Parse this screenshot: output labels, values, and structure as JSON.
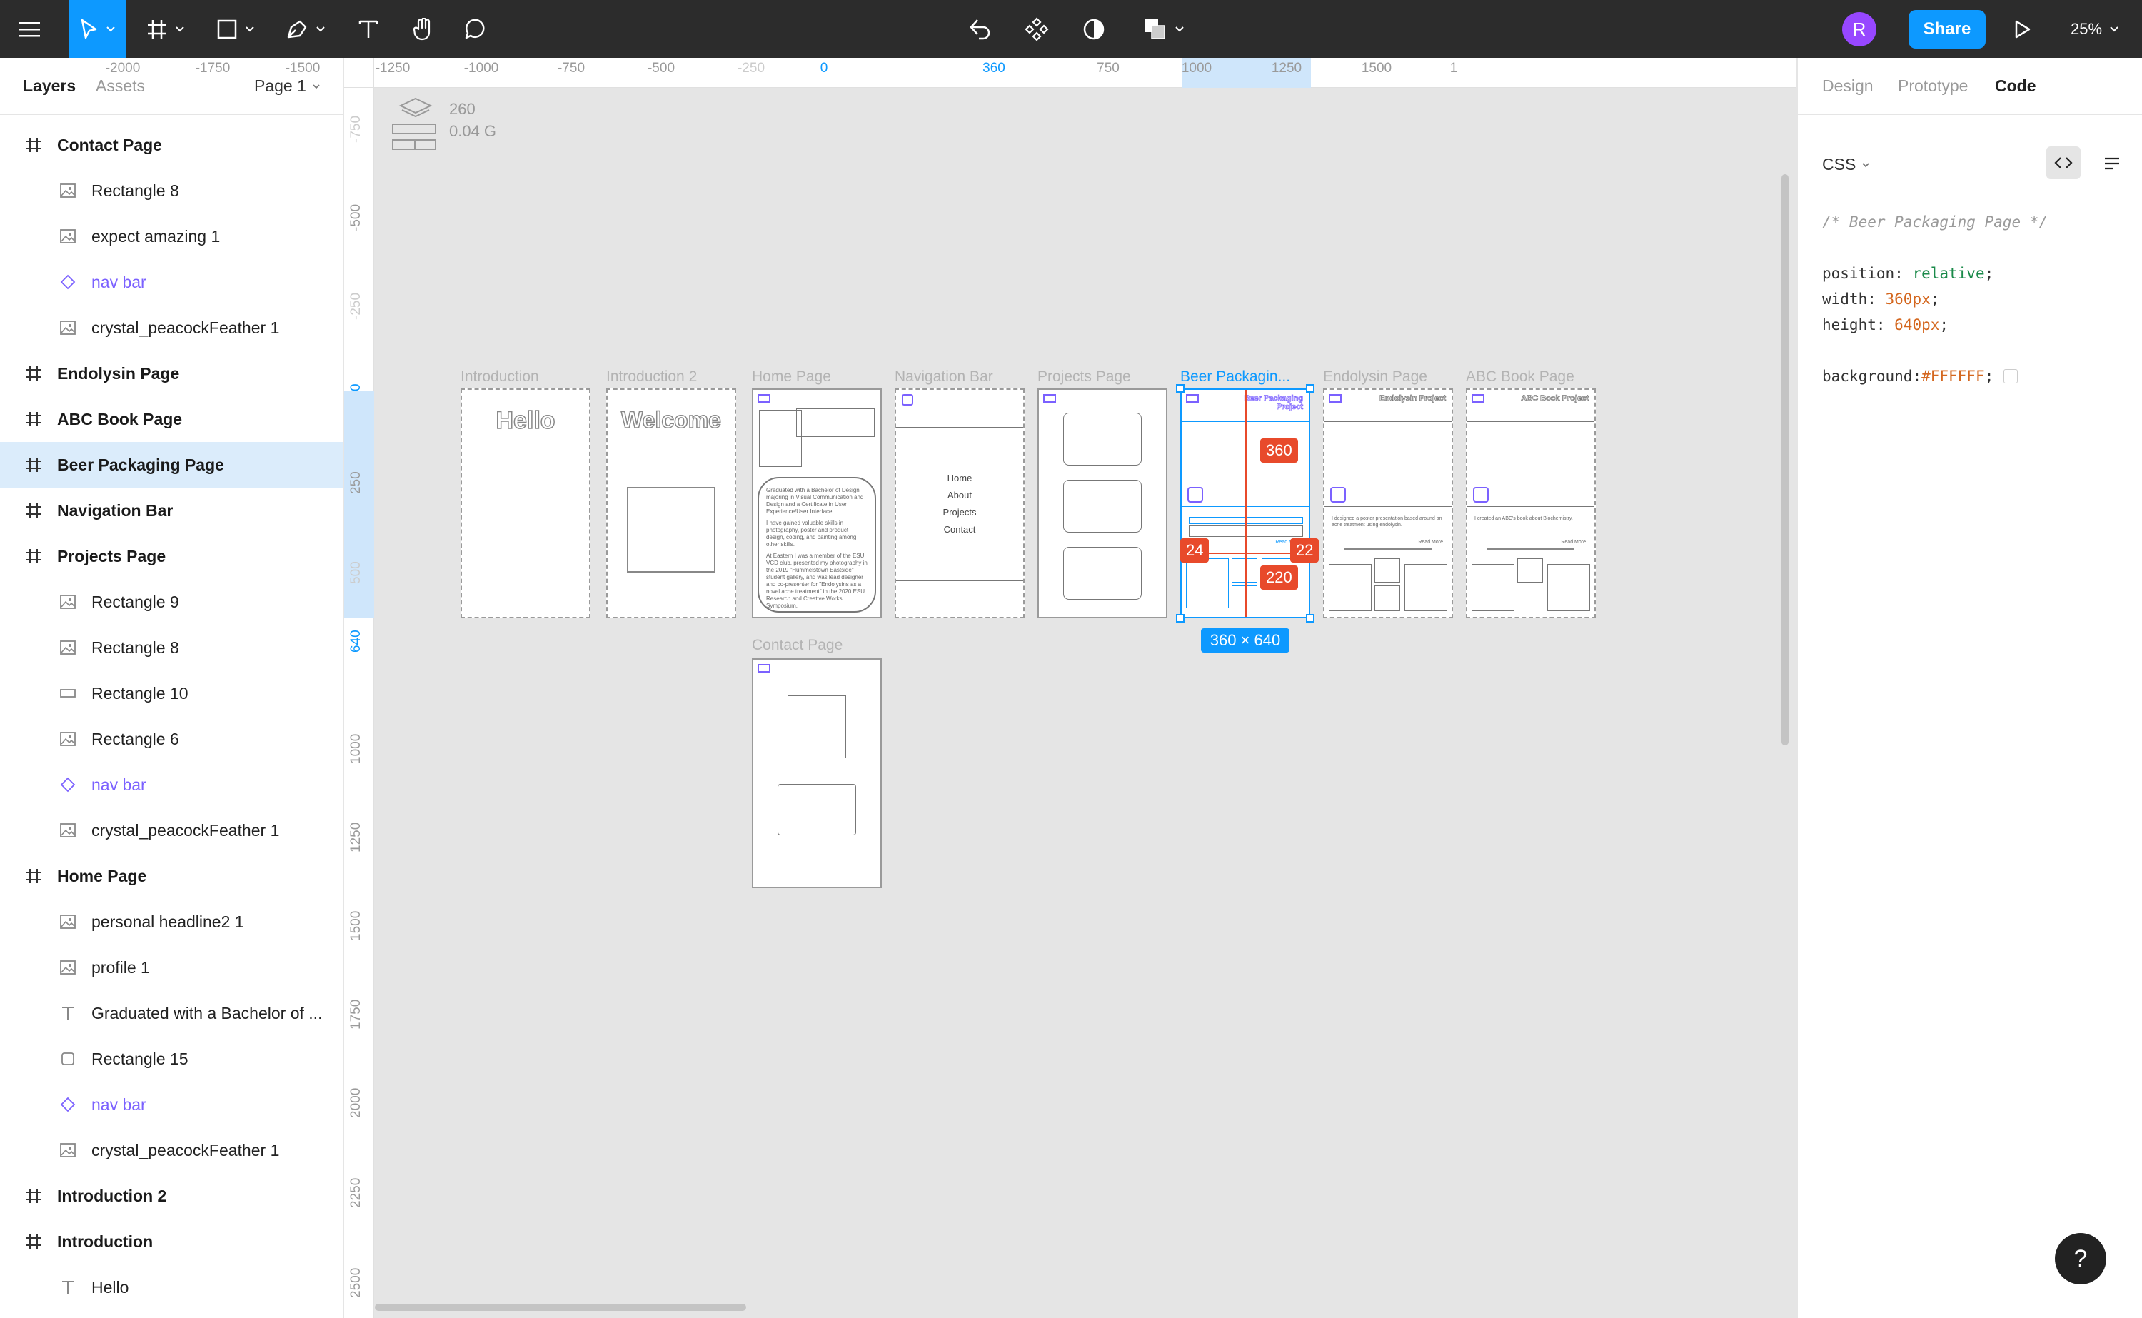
{
  "toolbar": {
    "avatar_initial": "R",
    "share_label": "Share",
    "zoom_label": "25%",
    "icons": [
      "menu-icon",
      "move-tool-icon",
      "frame-tool-icon",
      "shape-tool-icon",
      "pen-tool-icon",
      "text-tool-icon",
      "hand-tool-icon",
      "comment-tool-icon",
      "edit-object-icon",
      "component-icon",
      "mask-icon",
      "boolean-icon",
      "present-icon"
    ]
  },
  "left_panel": {
    "tabs": [
      "Layers",
      "Assets"
    ],
    "page_selector": "Page 1",
    "layers": [
      {
        "label": "Contact Page",
        "kind": "frame"
      },
      {
        "label": "Rectangle 8",
        "kind": "image"
      },
      {
        "label": "expect amazing 1",
        "kind": "image"
      },
      {
        "label": "nav bar",
        "kind": "component"
      },
      {
        "label": "crystal_peacockFeather 1",
        "kind": "image"
      },
      {
        "label": "Endolysin Page",
        "kind": "frame"
      },
      {
        "label": "ABC Book Page",
        "kind": "frame"
      },
      {
        "label": "Beer Packaging Page",
        "kind": "frame",
        "selected": true
      },
      {
        "label": "Navigation Bar",
        "kind": "frame"
      },
      {
        "label": "Projects Page",
        "kind": "frame"
      },
      {
        "label": "Rectangle 9",
        "kind": "image"
      },
      {
        "label": "Rectangle 8",
        "kind": "image"
      },
      {
        "label": "Rectangle 10",
        "kind": "rect"
      },
      {
        "label": "Rectangle 6",
        "kind": "image"
      },
      {
        "label": "nav bar",
        "kind": "component"
      },
      {
        "label": "crystal_peacockFeather 1",
        "kind": "image"
      },
      {
        "label": "Home Page",
        "kind": "frame"
      },
      {
        "label": "personal headline2 1",
        "kind": "image"
      },
      {
        "label": "profile 1",
        "kind": "image"
      },
      {
        "label": "Graduated with a Bachelor of ...",
        "kind": "text"
      },
      {
        "label": "Rectangle 15",
        "kind": "rounded"
      },
      {
        "label": "nav bar",
        "kind": "component"
      },
      {
        "label": "crystal_peacockFeather 1",
        "kind": "image"
      },
      {
        "label": "Introduction 2",
        "kind": "frame"
      },
      {
        "label": "Introduction",
        "kind": "frame"
      },
      {
        "label": "Hello",
        "kind": "text"
      }
    ]
  },
  "rulers": {
    "h_labels": [
      "-2000",
      "-1750",
      "-1500",
      "-1250",
      "-1000",
      "-750",
      "-500",
      "-250",
      "0",
      "360",
      "750",
      "1000",
      "1250",
      "1500",
      "1"
    ],
    "v_labels": [
      "-750",
      "-500",
      "-250",
      "0",
      "250",
      "500",
      "640",
      "1000",
      "1250",
      "1500",
      "1750",
      "2000",
      "2250",
      "2500"
    ]
  },
  "canvas": {
    "stats": {
      "count": "260",
      "size": "0.04 G"
    },
    "frames": [
      {
        "title": "Introduction",
        "content": "Hello"
      },
      {
        "title": "Introduction 2",
        "content": "Welcome"
      },
      {
        "title": "Home Page"
      },
      {
        "title": "Navigation Bar",
        "nav_items": [
          "Home",
          "About",
          "Projects",
          "Contact"
        ]
      },
      {
        "title": "Projects Page"
      },
      {
        "title": "Beer Packagin...",
        "header": "Beer Packaging Project",
        "link": "Read More"
      },
      {
        "title": "Endolysin Page",
        "header": "Endolysin Project",
        "body": "I designed a poster presentation based around an acne treatment using endolysin.",
        "link": "Read More"
      },
      {
        "title": "ABC Book Page",
        "header": "ABC Book Project",
        "body": "I created an ABC's book about Biochemistry.",
        "link": "Read More"
      },
      {
        "title": "Contact Page"
      }
    ],
    "home_text": [
      "Graduated with a Bachelor of Design majoring in Visual Communication and Design and a Certificate in User Experience/User Interface.",
      "I have gained valuable skills in photography, poster and product design, coding, and painting among other skills.",
      "At Eastern I was a member of the ESU VCD club, presented my photography in the 2019 \"Hummelstown Eastside\" student gallery, and was lead designer and co-presenter for \"Endolysins as a novel acne treatment\" in the 2020 ESU Research and Creative Works Symposium."
    ],
    "selection": {
      "size_label": "360 × 640",
      "width_badge": "360",
      "left_badge": "24",
      "right_badge": "22",
      "bottom_badge": "220"
    }
  },
  "right_panel": {
    "tabs": [
      "Design",
      "Prototype",
      "Code"
    ],
    "active_tab": "Code",
    "language": "CSS",
    "code": {
      "comment": "/* Beer Packaging Page */",
      "lines": [
        {
          "prop": "position",
          "value": "relative"
        },
        {
          "prop": "width",
          "value": "360px"
        },
        {
          "prop": "height",
          "value": "640px"
        },
        {
          "prop": "background",
          "value": "#FFFFFF"
        }
      ]
    }
  },
  "help_label": "?",
  "colors": {
    "accent": "#0d99ff",
    "toolbar": "#2c2c2c",
    "component": "#7b61ff",
    "measure": "#e84a2b",
    "selection_bg": "#dbecfb",
    "avatar": "#9747ff"
  }
}
